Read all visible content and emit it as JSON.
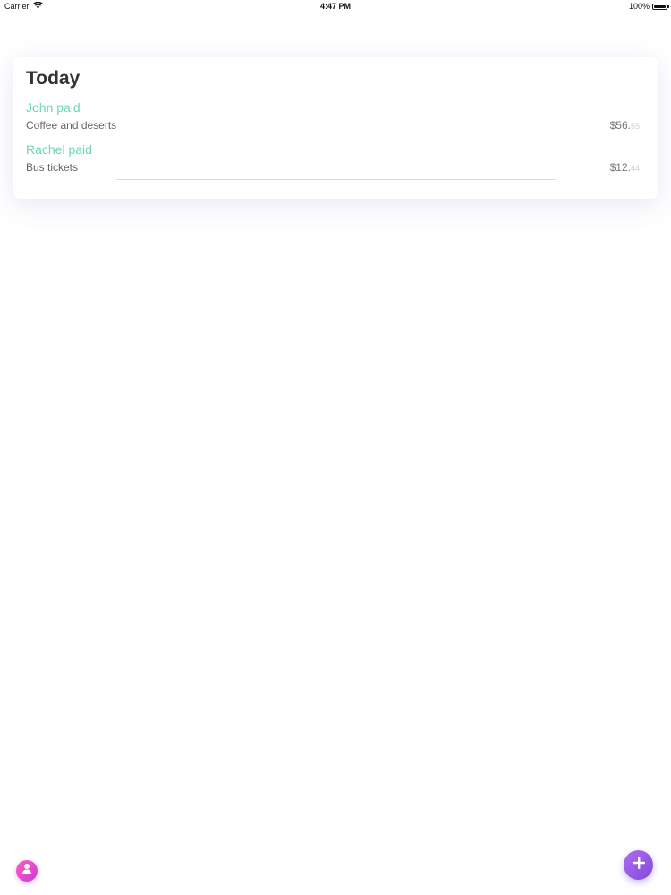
{
  "status_bar": {
    "carrier": "Carrier",
    "time": "4:47 PM",
    "battery": "100%",
    "battery_level": 1.0,
    "icons": [
      "wifi-icon",
      "battery-icon"
    ]
  },
  "card": {
    "title": "Today",
    "transactions": [
      {
        "payer": "John paid",
        "description": "Coffee and deserts",
        "amount_main": "$56.",
        "amount_cents": "55"
      },
      {
        "payer": "Rachel paid",
        "description": "Bus tickets",
        "amount_main": "$12.",
        "amount_cents": "44"
      }
    ]
  },
  "buttons": {
    "profile_icon": "person-icon",
    "add_icon": "plus-icon"
  },
  "colors": {
    "payer": "#6fd6b3",
    "profile_gradient": [
      "#ff5fc0",
      "#c83ad8"
    ],
    "add_gradient": [
      "#b06df0",
      "#7e4bdb"
    ]
  }
}
